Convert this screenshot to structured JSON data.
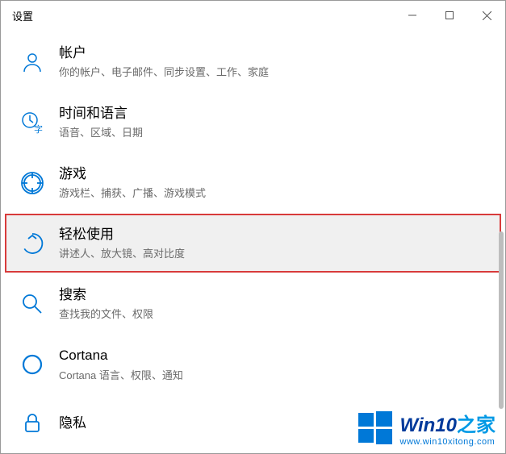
{
  "window": {
    "title": "设置"
  },
  "items": [
    {
      "title": "帐户",
      "desc": "你的帐户、电子邮件、同步设置、工作、家庭"
    },
    {
      "title": "时间和语言",
      "desc": "语音、区域、日期"
    },
    {
      "title": "游戏",
      "desc": "游戏栏、捕获、广播、游戏模式"
    },
    {
      "title": "轻松使用",
      "desc": "讲述人、放大镜、高对比度"
    },
    {
      "title": "搜索",
      "desc": "查找我的文件、权限"
    },
    {
      "title": "Cortana",
      "desc": "Cortana 语言、权限、通知"
    },
    {
      "title": "隐私",
      "desc": ""
    }
  ],
  "watermark": {
    "brand_prefix": "Win10",
    "brand_suffix": "之家",
    "url": "www.win10xitong.com"
  }
}
